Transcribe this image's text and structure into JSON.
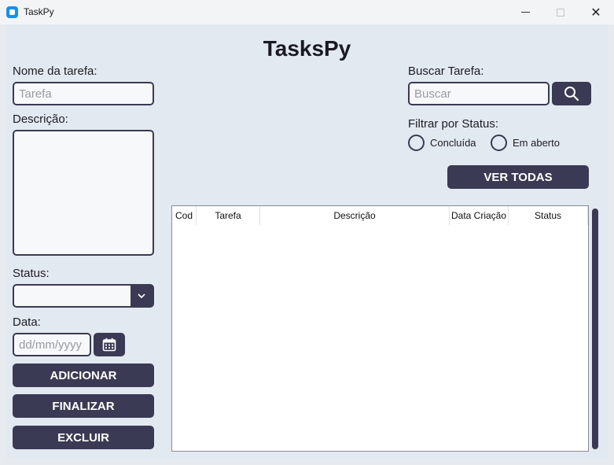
{
  "window": {
    "title": "TaskPy",
    "minimize": "",
    "maximize": "",
    "close": "✕"
  },
  "app_title": "TasksPy",
  "form": {
    "name_label": "Nome da tarefa:",
    "name_placeholder": "Tarefa",
    "description_label": "Descrição:",
    "status_label": "Status:",
    "status_value": "",
    "date_label": "Data:",
    "date_placeholder": "dd/mm/yyyy",
    "add_button": "ADICIONAR",
    "finish_button": "FINALIZAR",
    "delete_button": "EXCLUIR"
  },
  "search": {
    "label": "Buscar Tarefa:",
    "placeholder": "Buscar",
    "button_icon": "search-icon"
  },
  "filter": {
    "label": "Filtrar por Status:",
    "options": [
      "Concluída",
      "Em aberto"
    ],
    "view_all_button": "VER TODAS"
  },
  "table": {
    "columns": [
      "Cod",
      "Tarefa",
      "Descrição",
      "Data Criação",
      "Status"
    ],
    "rows": []
  },
  "colors": {
    "accent": "#3a3a54",
    "background": "#e3e9f0"
  }
}
